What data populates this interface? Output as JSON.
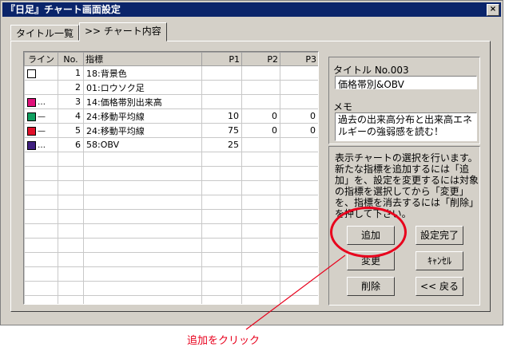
{
  "window": {
    "title": "『日足』チャート画面設定",
    "close_label": "×"
  },
  "tabs": [
    {
      "label": "タイトル一覧"
    },
    {
      "label": ">> チャート内容"
    }
  ],
  "grid": {
    "columns": [
      "ライン",
      "No.",
      "指標",
      "P1",
      "P2",
      "P3"
    ],
    "rows": [
      {
        "color": "#ffffff",
        "style": "",
        "no": "1",
        "name": "18:背景色",
        "p1": "",
        "p2": "",
        "p3": ""
      },
      {
        "color": "",
        "style": "",
        "no": "2",
        "name": "01:ロウソク足",
        "p1": "",
        "p2": "",
        "p3": ""
      },
      {
        "color": "#e0107a",
        "style": "…",
        "no": "3",
        "name": "14:価格帯別出来高",
        "p1": "",
        "p2": "",
        "p3": ""
      },
      {
        "color": "#10a060",
        "style": "—",
        "no": "4",
        "name": "24:移動平均線",
        "p1": "10",
        "p2": "0",
        "p3": "0"
      },
      {
        "color": "#e0102a",
        "style": "—",
        "no": "5",
        "name": "24:移動平均線",
        "p1": "75",
        "p2": "0",
        "p3": "0"
      },
      {
        "color": "#402080",
        "style": "…",
        "no": "6",
        "name": "58:OBV",
        "p1": "25",
        "p2": "",
        "p3": ""
      }
    ]
  },
  "title_field": {
    "label": "タイトル No.003",
    "value": "価格帯別&OBV"
  },
  "memo_field": {
    "label": "メモ",
    "value": "過去の出来高分布と出来高エネルギーの強弱感を読む！"
  },
  "description": "表示チャートの選択を行います。新たな指標を追加するには「追加」を、設定を変更するには対象の指標を選択してから「変更」を、指標を消去するには「削除」を押して下さい。",
  "buttons": {
    "add": "追加",
    "done": "設定完了",
    "change": "変更",
    "cancel": "ｷｬﾝｾﾙ",
    "delete": "削除",
    "back": "<< 戻る"
  },
  "annotation": {
    "text": "追加をクリック",
    "color": "#e8001c"
  }
}
